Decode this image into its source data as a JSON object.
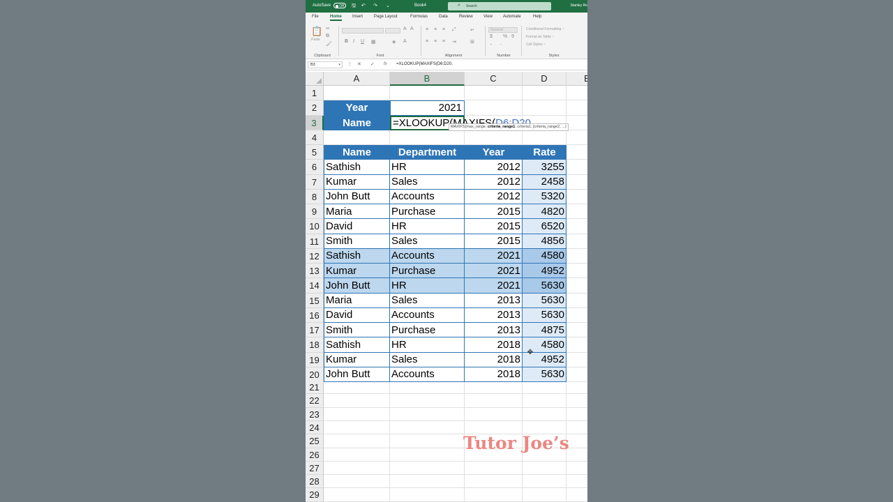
{
  "titlebar": {
    "autosave": "AutoSave",
    "autosave_state": "Off",
    "doc_name": "Book4",
    "search_placeholder": "Search",
    "user": "Stanley Ro"
  },
  "menu_tabs": [
    "File",
    "Home",
    "Insert",
    "Page Layout",
    "Formulas",
    "Data",
    "Review",
    "View",
    "Automate",
    "Help"
  ],
  "active_tab": "Home",
  "ribbon": {
    "clipboard": {
      "label": "Clipboard",
      "paste": "Paste"
    },
    "font": {
      "label": "Font"
    },
    "alignment": {
      "label": "Alignment"
    },
    "number": {
      "label": "Number",
      "format": "General"
    },
    "styles": {
      "label": "Styles",
      "conditional": "Conditional Formatting ~",
      "table": "Format as Table ~",
      "cell": "Cell Styles ~"
    }
  },
  "formula_bar": {
    "name_box": "B3",
    "formula": "=XLOOKUP(MAXIFS(D6:D20,"
  },
  "columns": [
    "A",
    "B",
    "C",
    "D",
    "E"
  ],
  "rows": [
    "1",
    "2",
    "3",
    "4",
    "5",
    "6",
    "7",
    "8",
    "9",
    "10",
    "11",
    "12",
    "13",
    "14",
    "15",
    "16",
    "17",
    "18",
    "19",
    "20",
    "21",
    "22",
    "23",
    "24",
    "25",
    "26",
    "27",
    "28",
    "29"
  ],
  "lookup": {
    "year_label": "Year",
    "year_value": "2021",
    "name_label": "Name",
    "edit_prefix": "=XLOOKUP(MAXIFS(",
    "edit_ref": "D6:D20",
    "edit_suffix": ",",
    "tooltip_prefix": "MAXIFS(max_range, ",
    "tooltip_bold": "criteria_range1",
    "tooltip_suffix": ", criteria1, [criteria_range2, ...)"
  },
  "table": {
    "headers": [
      "Name",
      "Department",
      "Year",
      "Rate"
    ],
    "rows": [
      [
        "Sathish",
        "HR",
        "2012",
        "3255"
      ],
      [
        "Kumar",
        "Sales",
        "2012",
        "2458"
      ],
      [
        "John Butt",
        "Accounts",
        "2012",
        "5320"
      ],
      [
        "Maria",
        "Purchase",
        "2015",
        "4820"
      ],
      [
        "David",
        "HR",
        "2015",
        "6520"
      ],
      [
        "Smith",
        "Sales",
        "2015",
        "4856"
      ],
      [
        "Sathish",
        "Accounts",
        "2021",
        "4580"
      ],
      [
        "Kumar",
        "Purchase",
        "2021",
        "4952"
      ],
      [
        "John Butt",
        "HR",
        "2021",
        "5630"
      ],
      [
        "Maria",
        "Sales",
        "2013",
        "5630"
      ],
      [
        "David",
        "Accounts",
        "2013",
        "5630"
      ],
      [
        "Smith",
        "Purchase",
        "2013",
        "4875"
      ],
      [
        "Sathish",
        "HR",
        "2018",
        "4580"
      ],
      [
        "Kumar",
        "Sales",
        "2018",
        "4952"
      ],
      [
        "John Butt",
        "Accounts",
        "2018",
        "5630"
      ]
    ],
    "highlighted_rows": [
      6,
      7,
      8
    ]
  },
  "watermark": "Tutor Joe’s",
  "colors": {
    "excel_green": "#1f6f43",
    "table_header": "#2e75b6",
    "highlight": "#bdd7ee",
    "rate_fill": "#deebf7",
    "watermark": "#ea8781"
  }
}
